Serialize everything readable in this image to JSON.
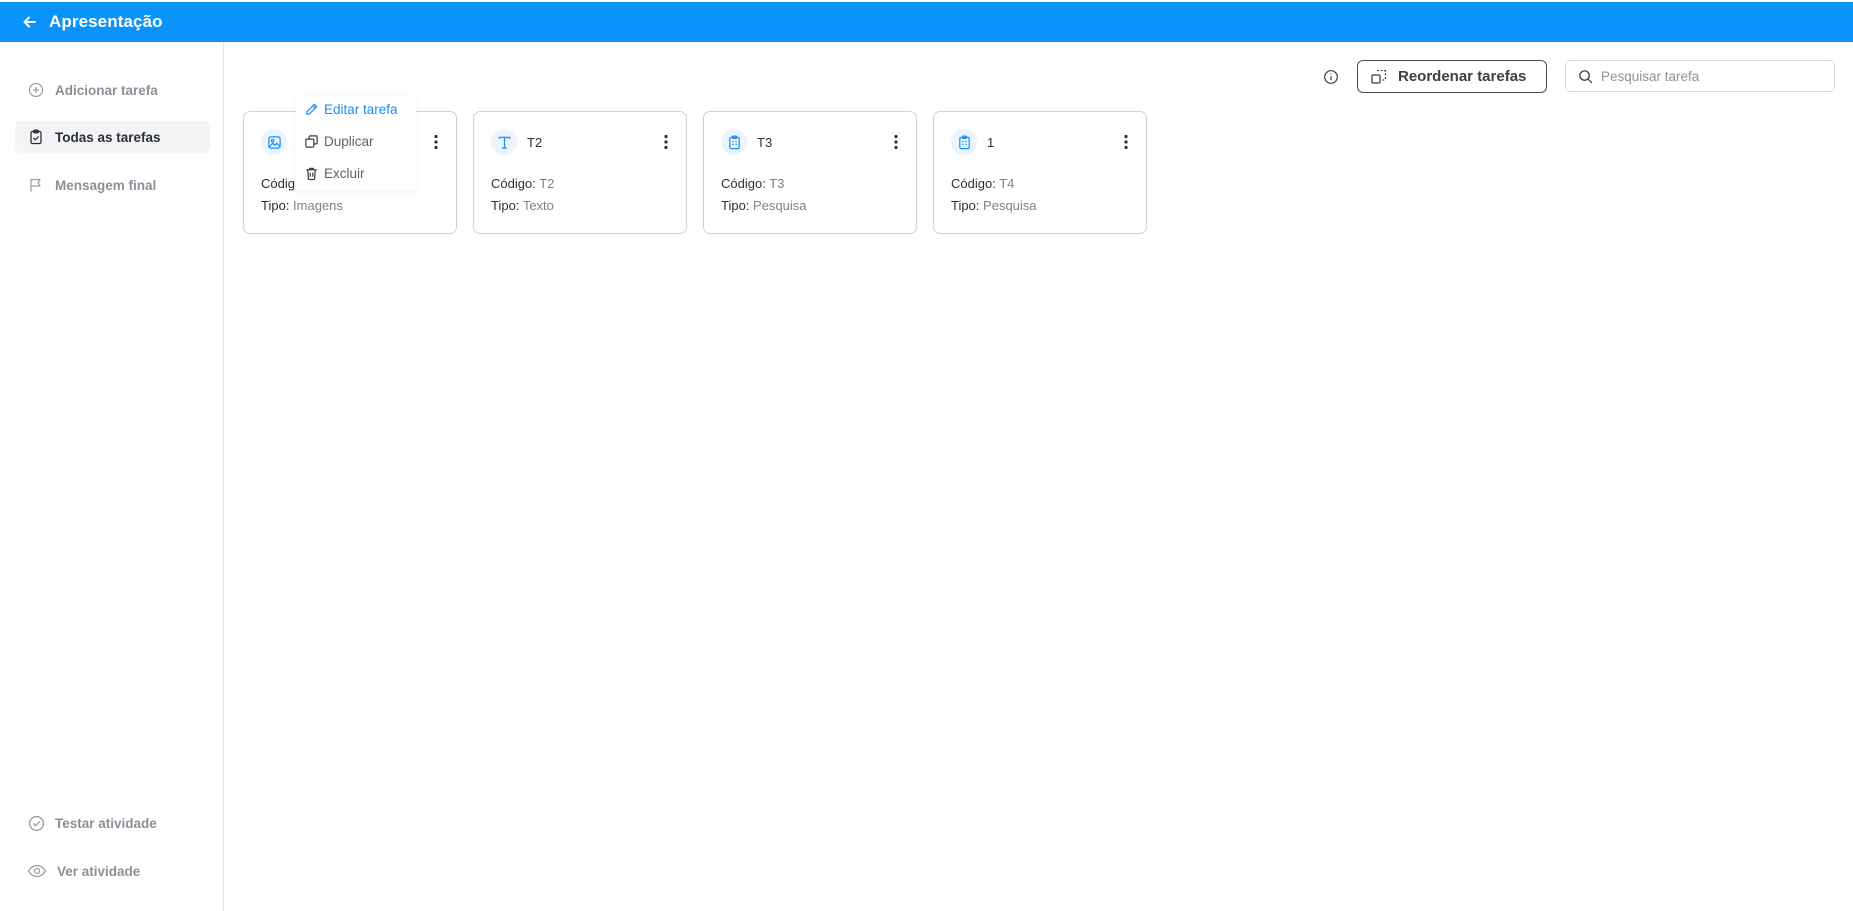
{
  "header": {
    "title": "Apresentação"
  },
  "sidebar": {
    "items": [
      {
        "label": "Adicionar tarefa",
        "icon": "plus-circle-icon"
      },
      {
        "label": "Todas as tarefas",
        "icon": "clipboard-check-icon",
        "active": true
      },
      {
        "label": "Mensagem final",
        "icon": "flag-icon"
      }
    ],
    "bottom_items": [
      {
        "label": "Testar atividade",
        "icon": "check-circle-icon"
      },
      {
        "label": "Ver atividade",
        "icon": "eye-icon"
      }
    ]
  },
  "toolbar": {
    "reorder_label": "Reordenar tarefas",
    "search_placeholder": "Pesquisar tarefa"
  },
  "labels": {
    "code": "Código:",
    "type": "Tipo:"
  },
  "tasks": [
    {
      "name": "",
      "code": "",
      "type": "Imagens",
      "icon": "image-icon"
    },
    {
      "name": "T2",
      "code": "T2",
      "type": "Texto",
      "icon": "text-icon"
    },
    {
      "name": "T3",
      "code": "T3",
      "type": "Pesquisa",
      "icon": "survey-icon"
    },
    {
      "name": "1",
      "code": "T4",
      "type": "Pesquisa",
      "icon": "survey-icon"
    }
  ],
  "card1_partial_code": "Códig",
  "context_menu": {
    "items": [
      {
        "label": "Editar tarefa",
        "icon": "pencil-icon"
      },
      {
        "label": "Duplicar",
        "icon": "copy-icon"
      },
      {
        "label": "Excluir",
        "icon": "trash-icon"
      }
    ]
  },
  "colors": {
    "primary": "#0a93fa",
    "accent_text": "#1a8ef5"
  }
}
